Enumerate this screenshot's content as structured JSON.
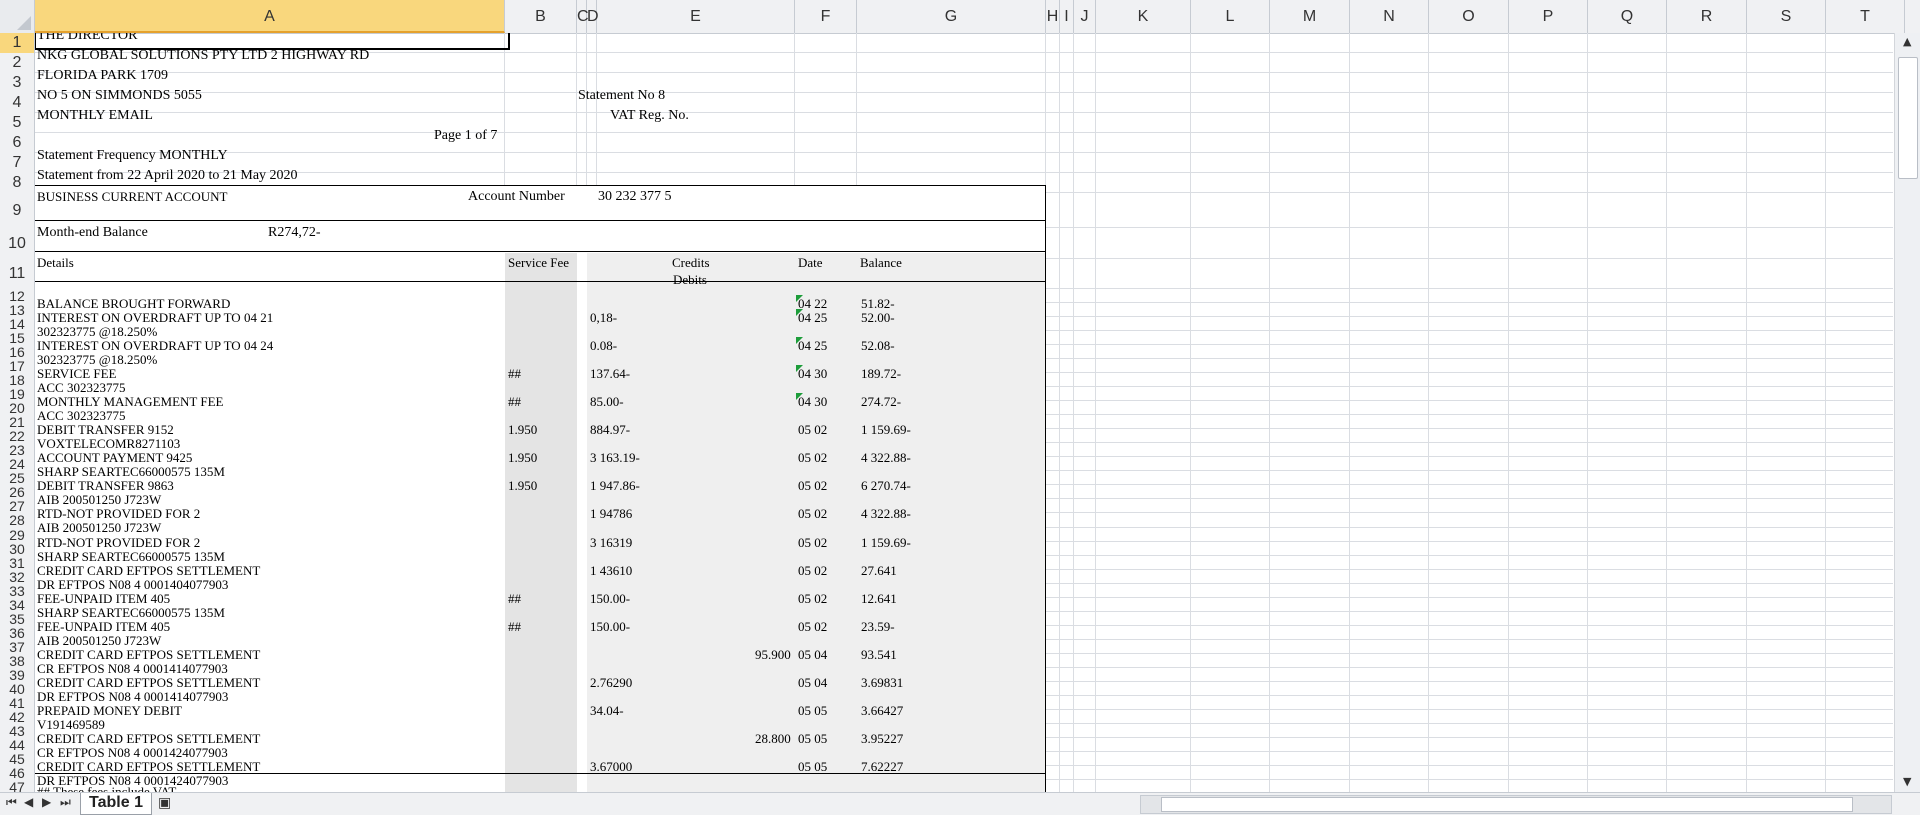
{
  "sheet": {
    "columns": [
      {
        "name": "col-A",
        "label": "A"
      },
      {
        "name": "col-B",
        "label": "B"
      },
      {
        "name": "col-C",
        "label": "C"
      },
      {
        "name": "col-D",
        "label": "D"
      },
      {
        "name": "col-E",
        "label": "E"
      },
      {
        "name": "col-F",
        "label": "F"
      },
      {
        "name": "col-G",
        "label": "G"
      },
      {
        "name": "col-H",
        "label": "H"
      },
      {
        "name": "col-I",
        "label": "I"
      },
      {
        "name": "col-J",
        "label": "J"
      },
      {
        "name": "col-K",
        "label": "K"
      },
      {
        "name": "col-L",
        "label": "L"
      },
      {
        "name": "col-M",
        "label": "M"
      },
      {
        "name": "col-N",
        "label": "N"
      },
      {
        "name": "col-O",
        "label": "O"
      },
      {
        "name": "col-P",
        "label": "P"
      },
      {
        "name": "col-Q",
        "label": "Q"
      },
      {
        "name": "col-R",
        "label": "R"
      },
      {
        "name": "col-S",
        "label": "S"
      },
      {
        "name": "col-T",
        "label": "T"
      }
    ],
    "rows": [
      "1",
      "2",
      "3",
      "4",
      "5",
      "6",
      "7",
      "8",
      "9",
      "10",
      "11",
      "12",
      "13",
      "14",
      "15",
      "16",
      "17",
      "18",
      "19",
      "20",
      "21",
      "22",
      "23",
      "24",
      "25",
      "26",
      "27",
      "28",
      "29",
      "30",
      "31",
      "32",
      "33",
      "34",
      "35",
      "36",
      "37",
      "38",
      "39",
      "40",
      "41",
      "42",
      "43",
      "44",
      "45",
      "46",
      "47"
    ],
    "selected_column": "A",
    "selected_row": "1",
    "tab_name": "Table 1",
    "accent_color": "#f9d77d",
    "green_marker": "#1d9d3a"
  },
  "header": {
    "director": "THE DIRECTOR",
    "company": "NKG GLOBAL SOLUTIONS PTY LTD 2 HIGHWAY RD",
    "suburb": "FLORIDA PARK 1709",
    "building": "NO 5 ON SIMMONDS  5055",
    "statement_no": "Statement No  8",
    "delivery": "MONTHLY   EMAIL",
    "vat": "VAT Reg. No.",
    "page": "Page 1 of 7",
    "frequency": "Statement Frequency MONTHLY",
    "period": "Statement from  22 April 2020 to 21 May 2020"
  },
  "account": {
    "type": "BUSINESS CURRENT ACCOUNT",
    "number_label": "Account Number",
    "number": "30 232 377 5",
    "balance_label": "Month-end Balance",
    "balance": "R274,72-"
  },
  "table_headers": {
    "details": "Details",
    "service_fee": "Service Fee",
    "credits": "Credits",
    "debits": "Debits",
    "date": "Date",
    "balance": "Balance"
  },
  "transactions": [
    {
      "r": 12,
      "details": "BALANCE BROUGHT FORWARD",
      "fee": "",
      "amount": "",
      "credit": "",
      "date": "04 22",
      "balance": "51.82-",
      "mark": true
    },
    {
      "r": 13,
      "details": "INTEREST ON OVERDRAFT UP TO 04 21",
      "fee": "",
      "amount": "0,18-",
      "credit": "",
      "date": "04 25",
      "balance": "52.00-",
      "mark": true
    },
    {
      "r": 14,
      "details": "302323775              @18.250%",
      "fee": "",
      "amount": "",
      "credit": "",
      "date": "",
      "balance": "",
      "mark": false
    },
    {
      "r": 15,
      "details": "INTEREST ON OVERDRAFT UP TO 04 24",
      "fee": "",
      "amount": "0.08-",
      "credit": "",
      "date": "04 25",
      "balance": "52.08-",
      "mark": true
    },
    {
      "r": 16,
      "details": "302323775              @18.250%",
      "fee": "",
      "amount": "",
      "credit": "",
      "date": "",
      "balance": "",
      "mark": false
    },
    {
      "r": 17,
      "details": "SERVICE FEE",
      "fee": "##",
      "amount": "137.64-",
      "credit": "",
      "date": "04 30",
      "balance": "189.72-",
      "mark": true
    },
    {
      "r": 18,
      "details": "ACC  302323775",
      "fee": "",
      "amount": "",
      "credit": "",
      "date": "",
      "balance": "",
      "mark": false
    },
    {
      "r": 19,
      "details": "MONTHLY MANAGEMENT FEE",
      "fee": "##",
      "amount": "85.00-",
      "credit": "",
      "date": "04 30",
      "balance": "274.72-",
      "mark": true
    },
    {
      "r": 20,
      "details": "ACC  302323775",
      "fee": "",
      "amount": "",
      "credit": "",
      "date": "",
      "balance": "",
      "mark": false
    },
    {
      "r": 21,
      "details": "DEBIT TRANSFER 9152",
      "fee": "1.950",
      "amount": "884.97-",
      "credit": "",
      "date": "05 02",
      "balance": "1 159.69-",
      "mark": false
    },
    {
      "r": 22,
      "details": "VOXTELECOMR8271103",
      "fee": "",
      "amount": "",
      "credit": "",
      "date": "",
      "balance": "",
      "mark": false
    },
    {
      "r": 23,
      "details": "ACCOUNT PAYMENT 9425",
      "fee": "1.950",
      "amount": "3 163.19-",
      "credit": "",
      "date": "05 02",
      "balance": "4 322.88-",
      "mark": false
    },
    {
      "r": 24,
      "details": "SHARP     SEARTEC66000575 135M",
      "fee": "",
      "amount": "",
      "credit": "",
      "date": "",
      "balance": "",
      "mark": false
    },
    {
      "r": 25,
      "details": "DEBIT TRANSFER 9863",
      "fee": "1.950",
      "amount": "1 947.86-",
      "credit": "",
      "date": "05 02",
      "balance": "6 270.74-",
      "mark": false
    },
    {
      "r": 26,
      "details": "AIB      200501250      J723W",
      "fee": "",
      "amount": "",
      "credit": "",
      "date": "",
      "balance": "",
      "mark": false
    },
    {
      "r": 27,
      "details": "RTD-NOT PROVIDED FOR 2",
      "fee": "",
      "amount": "1 94786",
      "credit": "",
      "date": "05 02",
      "balance": "4 322.88-",
      "mark": false
    },
    {
      "r": 28,
      "details": "AIB      200501250      J723W",
      "fee": "",
      "amount": "",
      "credit": "",
      "date": "",
      "balance": "",
      "mark": false
    },
    {
      "r": 29,
      "details": "RTD-NOT PROVIDED FOR 2",
      "fee": "",
      "amount": "3 16319",
      "credit": "",
      "date": "05 02",
      "balance": "1 159.69-",
      "mark": false
    },
    {
      "r": 30,
      "details": "SHARP     SEARTEC66000575 135M",
      "fee": "",
      "amount": "",
      "credit": "",
      "date": "",
      "balance": "",
      "mark": false
    },
    {
      "r": 31,
      "details": "CREDIT CARD EFTPOS SETTLEMENT",
      "fee": "",
      "amount": "1 43610",
      "credit": "",
      "date": "05 02",
      "balance": "27.641",
      "mark": false
    },
    {
      "r": 32,
      "details": "DR EFTPOS N08 4  0001404077903",
      "fee": "",
      "amount": "",
      "credit": "",
      "date": "",
      "balance": "",
      "mark": false
    },
    {
      "r": 33,
      "details": "FEE-UNPAID ITEM 405",
      "fee": "##",
      "amount": "150.00-",
      "credit": "",
      "date": "05 02",
      "balance": "12.641",
      "mark": false
    },
    {
      "r": 34,
      "details": "SHARP     SEARTEC66000575 135M",
      "fee": "",
      "amount": "",
      "credit": "",
      "date": "",
      "balance": "",
      "mark": false
    },
    {
      "r": 35,
      "details": "FEE-UNPAID ITEM 405",
      "fee": "##",
      "amount": "150.00-",
      "credit": "",
      "date": "05 02",
      "balance": "23.59-",
      "mark": false
    },
    {
      "r": 36,
      "details": "AIB      200501250      J723W",
      "fee": "",
      "amount": "",
      "credit": "",
      "date": "",
      "balance": "",
      "mark": false
    },
    {
      "r": 37,
      "details": "CREDIT CARD EFTPOS SETTLEMENT",
      "fee": "",
      "amount": "",
      "credit": "95.900",
      "date": "05 04",
      "balance": "93.541",
      "mark": false
    },
    {
      "r": 38,
      "details": "CR EFTPOS N08  4  0001414077903",
      "fee": "",
      "amount": "",
      "credit": "",
      "date": "",
      "balance": "",
      "mark": false
    },
    {
      "r": 39,
      "details": "CREDIT CARD EFTPOS SETTLEMENT",
      "fee": "",
      "amount": "2.76290",
      "credit": "",
      "date": "05 04",
      "balance": "3.69831",
      "mark": false
    },
    {
      "r": 40,
      "details": "DR EFTPOS N08 4  0001414077903",
      "fee": "",
      "amount": "",
      "credit": "",
      "date": "",
      "balance": "",
      "mark": false
    },
    {
      "r": 41,
      "details": "PREPAID MONEY DEBIT",
      "fee": "",
      "amount": "34.04-",
      "credit": "",
      "date": "05 05",
      "balance": "3.66427",
      "mark": false
    },
    {
      "r": 42,
      "details": "V191469589",
      "fee": "",
      "amount": "",
      "credit": "",
      "date": "",
      "balance": "",
      "mark": false
    },
    {
      "r": 43,
      "details": "CREDIT CARD EFTPOS SETTLEMENT",
      "fee": "",
      "amount": "",
      "credit": "28.800",
      "date": "05 05",
      "balance": "3.95227",
      "mark": false
    },
    {
      "r": 44,
      "details": "CR EFTPOS N08  4  0001424077903",
      "fee": "",
      "amount": "",
      "credit": "",
      "date": "",
      "balance": "",
      "mark": false
    },
    {
      "r": 45,
      "details": "CREDIT CARD EFTPOS SETTLEMENT",
      "fee": "",
      "amount": "3.67000",
      "credit": "",
      "date": "05 05",
      "balance": "7.62227",
      "mark": false
    },
    {
      "r": 46,
      "details": "DR EFTPOS N08 4  0001424077903",
      "fee": "",
      "amount": "",
      "credit": "",
      "date": "",
      "balance": "",
      "mark": false
    }
  ],
  "footnote": "## These fees include VAT",
  "icons": {
    "first": "first-sheet-icon",
    "prev": "prev-sheet-icon",
    "next": "next-sheet-icon",
    "last": "last-sheet-icon",
    "new_sheet": "insert-sheet-icon"
  }
}
